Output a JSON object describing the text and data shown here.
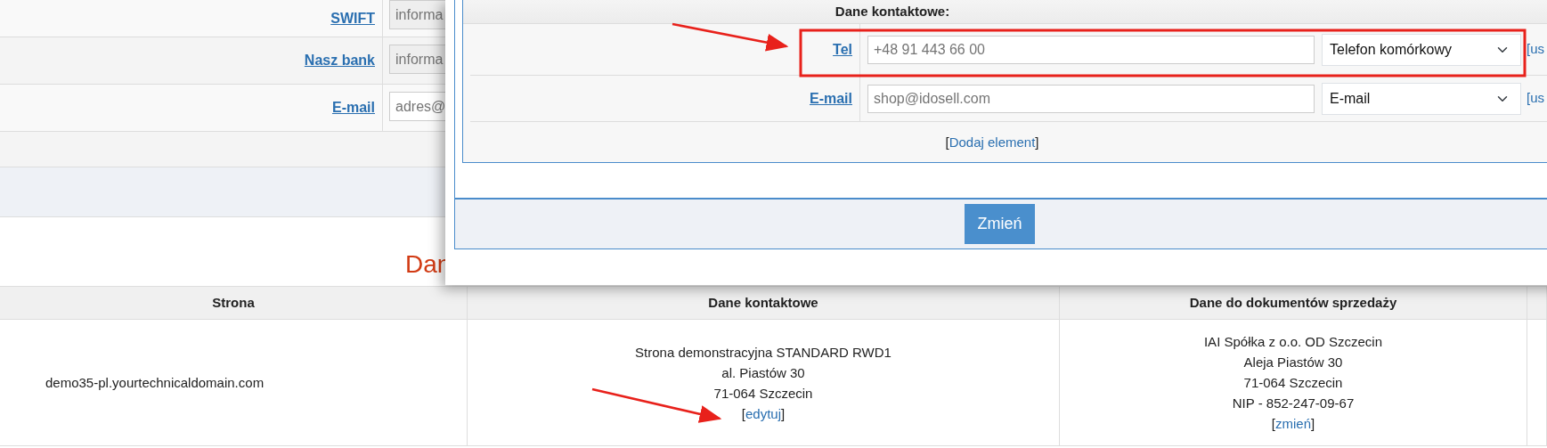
{
  "background_form": {
    "rows": [
      {
        "label": "SWIFT",
        "placeholder": "informa",
        "disabled": true
      },
      {
        "label": "Nasz bank",
        "placeholder": "informa",
        "disabled": true
      },
      {
        "label": "E-mail",
        "placeholder": "adres@",
        "disabled": false
      }
    ]
  },
  "section_title": "Dan",
  "table": {
    "columns": [
      "Strona",
      "Dane kontaktowe",
      "Dane do dokumentów sprzedaży"
    ],
    "rows": [
      {
        "site": "demo35-pl.yourtechnicaldomain.com",
        "contact": {
          "lines": [
            "Strona demonstracyjna STANDARD RWD1",
            "al. Piastów 30",
            "71-064 Szczecin"
          ],
          "open": "[",
          "link": "edytuj",
          "close": "]"
        },
        "documents": {
          "lines": [
            "IAI Spółka z o.o. OD Szczecin",
            "Aleja Piastów 30",
            "71-064 Szczecin",
            "NIP - 852-247-09-67"
          ],
          "open": "[",
          "link": "zmień",
          "close": "]"
        }
      }
    ]
  },
  "dialog": {
    "section_title": "Dane kontaktowe:",
    "rows": [
      {
        "label": "Tel",
        "placeholder": "+48 91 443 66 00",
        "type": "Telefon komórkowy",
        "action": "[us"
      },
      {
        "label": "E-mail",
        "placeholder": "shop@idosell.com",
        "type": "E-mail",
        "action": "[us"
      }
    ],
    "add": {
      "open": "[",
      "link": "Dodaj element",
      "close": "]"
    },
    "submit": "Zmień"
  }
}
